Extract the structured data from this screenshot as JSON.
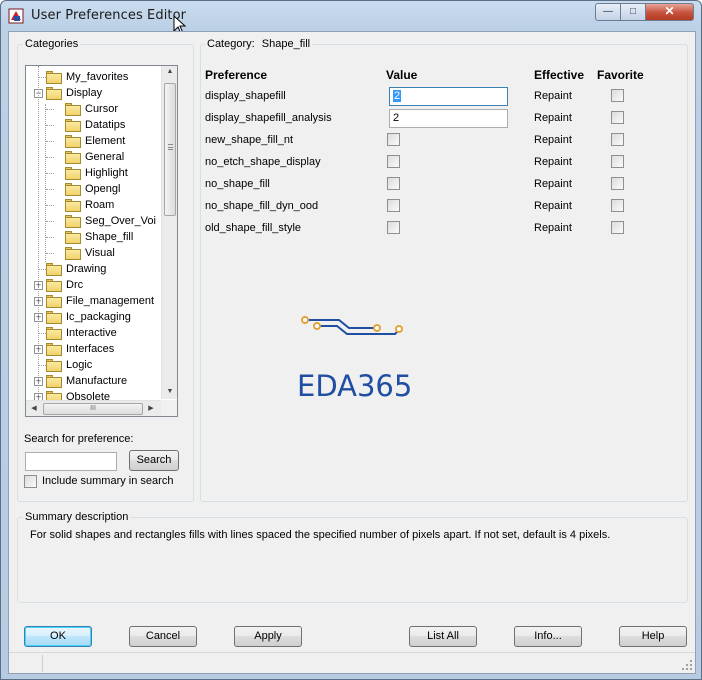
{
  "window": {
    "title": "User Preferences Editor",
    "controls": {
      "minimize": "—",
      "maximize": "□",
      "close": "✕"
    }
  },
  "categories": {
    "label": "Categories",
    "tree": [
      {
        "label": "My_favorites",
        "level": 0,
        "expander": ""
      },
      {
        "label": "Display",
        "level": 0,
        "expander": "−"
      },
      {
        "label": "Cursor",
        "level": 1,
        "expander": ""
      },
      {
        "label": "Datatips",
        "level": 1,
        "expander": ""
      },
      {
        "label": "Element",
        "level": 1,
        "expander": ""
      },
      {
        "label": "General",
        "level": 1,
        "expander": ""
      },
      {
        "label": "Highlight",
        "level": 1,
        "expander": ""
      },
      {
        "label": "Opengl",
        "level": 1,
        "expander": ""
      },
      {
        "label": "Roam",
        "level": 1,
        "expander": ""
      },
      {
        "label": "Seg_Over_Voi",
        "level": 1,
        "expander": ""
      },
      {
        "label": "Shape_fill",
        "level": 1,
        "expander": ""
      },
      {
        "label": "Visual",
        "level": 1,
        "expander": ""
      },
      {
        "label": "Drawing",
        "level": 0,
        "expander": ""
      },
      {
        "label": "Drc",
        "level": 0,
        "expander": "+"
      },
      {
        "label": "File_management",
        "level": 0,
        "expander": "+"
      },
      {
        "label": "Ic_packaging",
        "level": 0,
        "expander": "+"
      },
      {
        "label": "Interactive",
        "level": 0,
        "expander": ""
      },
      {
        "label": "Interfaces",
        "level": 0,
        "expander": "+"
      },
      {
        "label": "Logic",
        "level": 0,
        "expander": ""
      },
      {
        "label": "Manufacture",
        "level": 0,
        "expander": "+"
      },
      {
        "label": "Obsolete",
        "level": 0,
        "expander": "+"
      }
    ],
    "hscroll_thumb_label": "III"
  },
  "search": {
    "label": "Search for preference:",
    "value": "",
    "button": "Search",
    "include_summary_label": "Include summary in search",
    "include_summary_checked": false
  },
  "category_panel": {
    "category_prefix": "Category:",
    "category_name": "Shape_fill",
    "columns": {
      "preference": "Preference",
      "value": "Value",
      "effective": "Effective",
      "favorite": "Favorite"
    },
    "rows": [
      {
        "name": "display_shapefill",
        "value": "2",
        "kind": "text",
        "selected": true,
        "effective": "Repaint",
        "favorite": false
      },
      {
        "name": "display_shapefill_analysis",
        "value": "2",
        "kind": "text",
        "selected": false,
        "effective": "Repaint",
        "favorite": false
      },
      {
        "name": "new_shape_fill_nt",
        "value": "",
        "kind": "checkbox",
        "selected": false,
        "effective": "Repaint",
        "favorite": false
      },
      {
        "name": "no_etch_shape_display",
        "value": "",
        "kind": "checkbox",
        "selected": false,
        "effective": "Repaint",
        "favorite": false
      },
      {
        "name": "no_shape_fill",
        "value": "",
        "kind": "checkbox",
        "selected": false,
        "effective": "Repaint",
        "favorite": false
      },
      {
        "name": "no_shape_fill_dyn_ood",
        "value": "",
        "kind": "checkbox",
        "selected": false,
        "effective": "Repaint",
        "favorite": false
      },
      {
        "name": "old_shape_fill_style",
        "value": "",
        "kind": "checkbox",
        "selected": false,
        "effective": "Repaint",
        "favorite": false
      }
    ],
    "watermark": "EDA365"
  },
  "summary": {
    "label": "Summary description",
    "text": "For solid shapes and rectangles fills with lines spaced the specified number of pixels apart. If not set, default is 4 pixels."
  },
  "buttons": {
    "ok": "OK",
    "cancel": "Cancel",
    "apply": "Apply",
    "list_all": "List All",
    "info": "Info...",
    "help": "Help"
  },
  "colors": {
    "title_bar": "#bcd0e6",
    "dialog_bg": "#f0f0f0",
    "selection": "#3399ff",
    "logo_blue": "#1f4ea3",
    "logo_orange": "#e3a33b",
    "close_button": "#c6523c"
  }
}
